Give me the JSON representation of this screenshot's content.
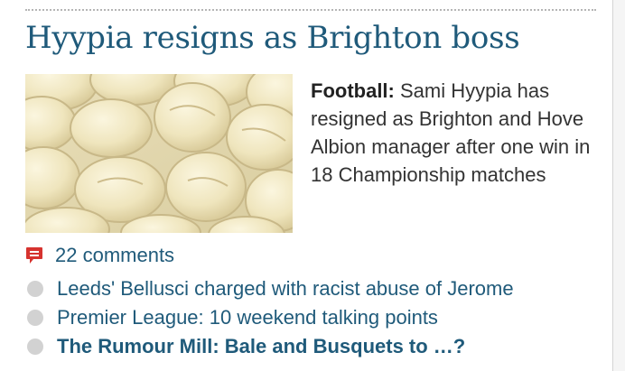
{
  "story": {
    "headline": "Hyypia resigns as Brighton boss",
    "kicker": "Football:",
    "summary": "Sami Hyypia has resigned as Brighton and Hove Albion manager after one win in 18 Championship matches",
    "image": {
      "subject": "Pile of pale yellow pills",
      "colors": {
        "pill_light": "#f4eccb",
        "pill_mid": "#eadfae",
        "pill_shadow": "#c9b98a",
        "background": "#eee6c6"
      }
    }
  },
  "comments": {
    "count_label": "22 comments",
    "icon": "comment-speech-bubble-icon",
    "icon_color": "#d6332f"
  },
  "related": [
    {
      "label": "Leeds' Bellusci charged with racist abuse of Jerome",
      "bold": false
    },
    {
      "label": "Premier League: 10 weekend talking points",
      "bold": false
    },
    {
      "label": "The Rumour Mill: Bale and Busquets to …?",
      "bold": true
    }
  ],
  "colors": {
    "link": "#1f5a7a",
    "body_text": "#333333",
    "bullet": "#d2d2d2"
  }
}
